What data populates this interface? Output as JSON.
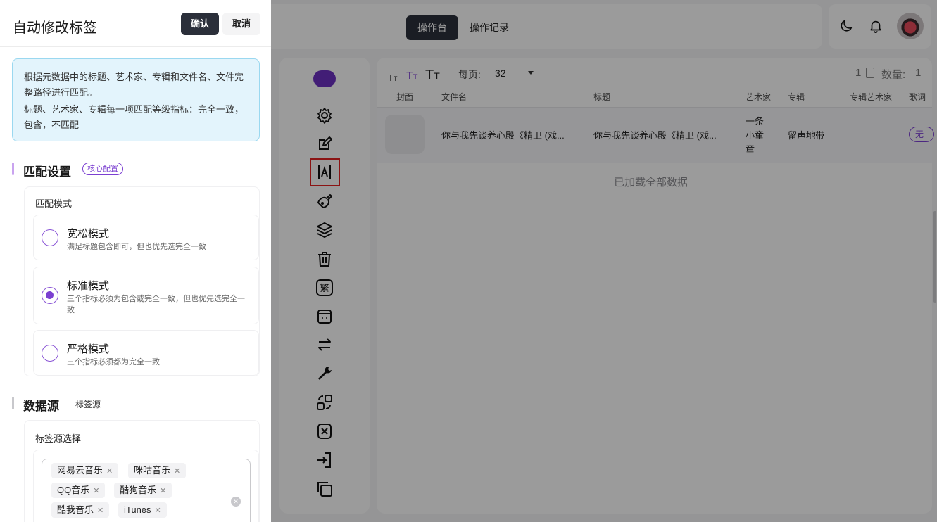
{
  "drawer": {
    "title": "自动修改标签",
    "confirm_label": "确认",
    "cancel_label": "取消",
    "info_line1": "根据元数据中的标题、艺术家、专辑和文件名、文件完整路径进行匹配。",
    "info_line2": "标题、艺术家、专辑每一项匹配等级指标：完全一致，包含，不匹配",
    "match_section": {
      "title": "匹配设置",
      "badge": "核心配置",
      "mode_label": "匹配模式",
      "options": [
        {
          "title": "宽松模式",
          "desc": "满足标题包含即可，但也优先选完全一致",
          "checked": false
        },
        {
          "title": "标准模式",
          "desc": "三个指标必须为包含或完全一致，但也优先选完全一致",
          "checked": true
        },
        {
          "title": "严格模式",
          "desc": "三个指标必须都为完全一致",
          "checked": false
        }
      ]
    },
    "source_section": {
      "title": "数据源",
      "tag": "标签源",
      "select_label": "标签源选择",
      "chips": [
        "网易云音乐",
        "咪咕音乐",
        "QQ音乐",
        "酷狗音乐",
        "酷我音乐",
        "iTunes"
      ]
    }
  },
  "topbar": {
    "tabs": [
      "操作台",
      "操作记录"
    ],
    "active_tab": "操作台",
    "icons": [
      "moon-icon",
      "bell-icon"
    ]
  },
  "sidebar": {
    "icons": [
      "gear-icon",
      "edit-icon",
      "auto-tag-icon",
      "guitar-icon",
      "layers-icon",
      "trash-icon",
      "traditional-chinese-icon",
      "window-icon",
      "swap-icon",
      "wrench-icon",
      "convert-icon",
      "rotate-icon",
      "import-icon",
      "copy-icon"
    ]
  },
  "table": {
    "per_page_label": "每页:",
    "per_page_value": "32",
    "page_number": "1",
    "count_label": "数量:",
    "count_value": "1",
    "columns": [
      "封面",
      "文件名",
      "标题",
      "艺术家",
      "专辑",
      "专辑艺术家",
      "歌词"
    ],
    "rows": [
      {
        "filename": "你与我先谈养心殿《精卫 (戏...",
        "title": "你与我先谈养心殿《精卫 (戏...",
        "artist_lines": [
          "一条",
          "小童",
          "童"
        ],
        "album": "留声地带",
        "album_artist": "",
        "lyrics": "无"
      }
    ],
    "footer_text": "已加载全部数据"
  },
  "colors": {
    "accent": "#7b3fd1",
    "dark": "#2b2f3a",
    "highlight_border": "#e02020"
  }
}
